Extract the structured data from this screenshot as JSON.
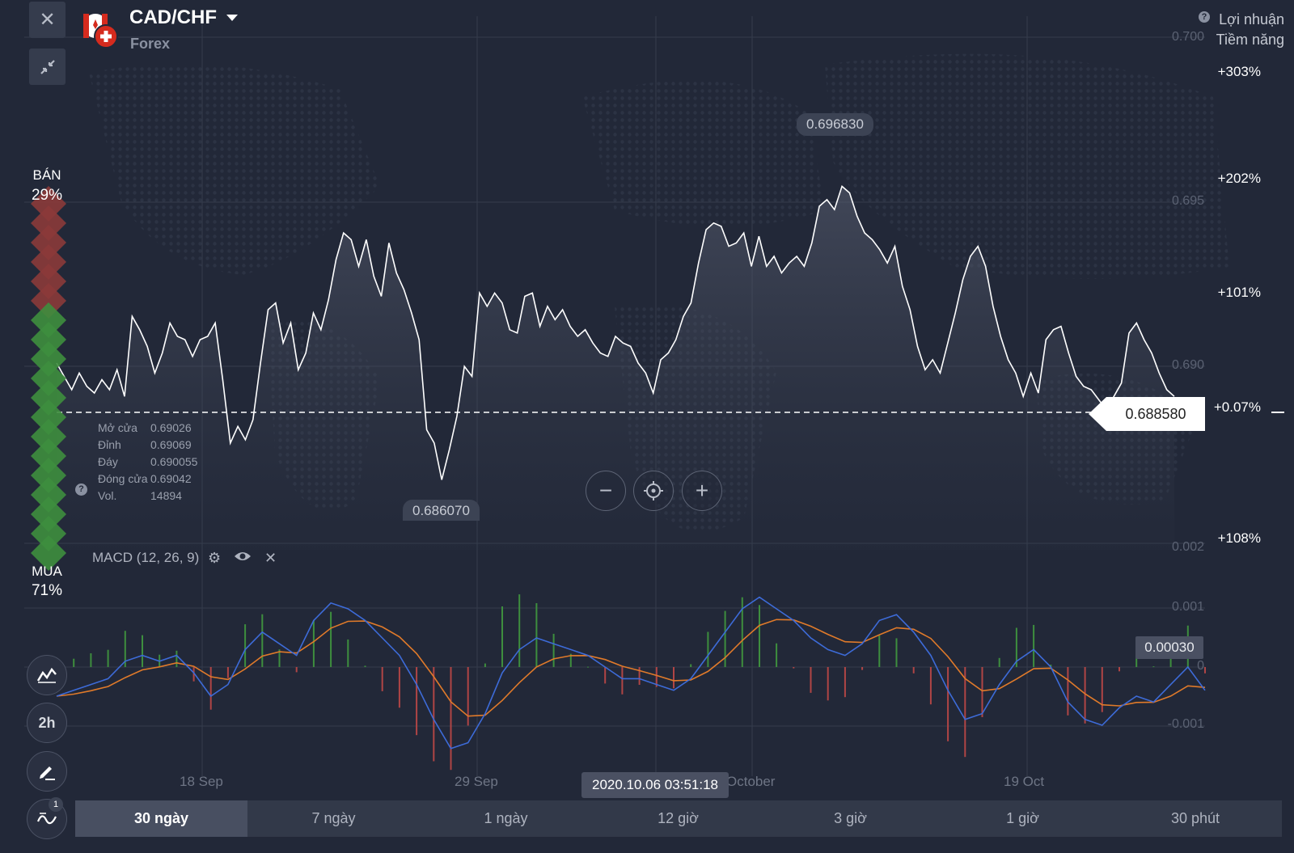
{
  "asset": {
    "name": "CAD/CHF",
    "type": "Forex"
  },
  "profit": {
    "title_line1": "Lợi nhuận",
    "title_line2": "Tiềm năng",
    "help": "?"
  },
  "profit_scale": [
    "+303%",
    "+202%",
    "+101%",
    "+0.07%",
    "+108%"
  ],
  "price_axis": [
    "0.700",
    "0.695",
    "0.690"
  ],
  "macd_axis": [
    "0.002",
    "0.001",
    "0",
    "-0.001"
  ],
  "sentiment": {
    "sell_label": "BÁN",
    "sell_pct": "29%",
    "buy_label": "MUA",
    "buy_pct": "71%",
    "sell_color": "#8b3a3a",
    "buy_color": "#3e8e3e"
  },
  "ohlc": {
    "open_label": "Mở cửa",
    "open": "0.69026",
    "high_label": "Đỉnh",
    "high": "0.69069",
    "low_label": "Đáy",
    "low": "0.690055",
    "close_label": "Đóng cửa",
    "close": "0.69042",
    "vol_label": "Vol.",
    "vol": "14894"
  },
  "markers": {
    "current_price": "0.688580",
    "high_bubble": "0.696830",
    "low_bubble": "0.686070"
  },
  "macd": {
    "label": "MACD (12, 26, 9)",
    "value": "0.00030",
    "line_color": "#3d6bd8",
    "signal_color": "#e07a2a"
  },
  "x_axis": [
    "18 Sep",
    "29 Sep",
    "October",
    "19 Oct"
  ],
  "time_tooltip": "2020.10.06 03:51:18",
  "tools": {
    "time_frame": "2h",
    "indicator_count": "1"
  },
  "timeframes": [
    "30 ngày",
    "7 ngày",
    "1 ngày",
    "12 giờ",
    "3 giờ",
    "1 giờ",
    "30 phút"
  ],
  "icons": {
    "close": "close-icon",
    "collapse": "collapse-icon",
    "zoom_out": "minus-icon",
    "center": "crosshair-icon",
    "zoom_in": "plus-icon"
  },
  "chart_data": {
    "type": "line",
    "ylim": [
      0.684,
      0.7
    ],
    "current": 0.68858,
    "x": [
      0,
      1,
      2,
      3,
      4,
      5,
      6,
      7,
      8,
      9,
      10,
      11,
      12,
      13,
      14,
      15,
      16,
      17,
      18,
      19,
      20,
      21,
      22,
      23,
      24,
      25,
      26,
      27,
      28,
      29,
      30,
      31,
      32,
      33,
      34,
      35,
      36,
      37,
      38,
      39,
      40,
      41,
      42,
      43,
      44,
      45,
      46,
      47,
      48,
      49,
      50,
      51,
      52,
      53,
      54,
      55,
      56,
      57,
      58,
      59,
      60,
      61,
      62,
      63,
      64,
      65,
      66,
      67,
      68,
      69,
      70,
      71,
      72,
      73,
      74,
      75,
      76,
      77,
      78,
      79,
      80,
      81,
      82,
      83,
      84,
      85,
      86,
      87,
      88,
      89,
      90,
      91,
      92,
      93,
      94,
      95,
      96,
      97,
      98,
      99,
      100,
      101,
      102,
      103,
      104,
      105,
      106,
      107,
      108,
      109,
      110,
      111,
      112,
      113,
      114,
      115,
      116,
      117,
      118,
      119,
      120,
      121,
      122,
      123,
      124,
      125,
      126,
      127,
      128,
      129,
      130,
      131,
      132,
      133,
      134,
      135,
      136,
      137,
      138,
      139,
      140,
      141,
      142,
      143,
      144,
      145,
      146,
      147,
      148,
      149,
      150,
      151,
      152,
      153,
      154,
      155,
      156,
      157,
      158,
      159,
      160,
      161,
      162,
      163,
      164,
      165,
      166,
      167,
      168,
      169,
      170,
      171,
      172,
      173,
      174,
      175,
      176,
      177,
      178,
      179
    ],
    "price": [
      0.6896,
      0.6892,
      0.6888,
      0.6893,
      0.6889,
      0.6887,
      0.6891,
      0.6888,
      0.6894,
      0.6886,
      0.691,
      0.6906,
      0.6901,
      0.6893,
      0.6899,
      0.6908,
      0.6904,
      0.6903,
      0.6898,
      0.6903,
      0.6904,
      0.6908,
      0.6891,
      0.6872,
      0.6877,
      0.6873,
      0.6879,
      0.6896,
      0.6912,
      0.6914,
      0.6902,
      0.6908,
      0.6894,
      0.6899,
      0.6911,
      0.6906,
      0.6915,
      0.6927,
      0.6935,
      0.6933,
      0.6925,
      0.6933,
      0.6922,
      0.6916,
      0.6932,
      0.6923,
      0.6918,
      0.6911,
      0.6903,
      0.6876,
      0.6872,
      0.6861,
      0.687,
      0.688,
      0.6895,
      0.6892,
      0.6917,
      0.6913,
      0.6917,
      0.6914,
      0.6906,
      0.6905,
      0.6916,
      0.6917,
      0.6907,
      0.6913,
      0.6909,
      0.6912,
      0.6907,
      0.6904,
      0.6906,
      0.6902,
      0.6899,
      0.6898,
      0.6904,
      0.6902,
      0.6901,
      0.6896,
      0.6893,
      0.6887,
      0.6897,
      0.6899,
      0.6903,
      0.691,
      0.6914,
      0.6926,
      0.6936,
      0.6938,
      0.6937,
      0.6931,
      0.6932,
      0.6935,
      0.6925,
      0.6934,
      0.6925,
      0.6928,
      0.6923,
      0.6926,
      0.6928,
      0.6925,
      0.6932,
      0.6943,
      0.6945,
      0.6942,
      0.6949,
      0.6947,
      0.694,
      0.6935,
      0.6933,
      0.693,
      0.6926,
      0.6931,
      0.6919,
      0.6912,
      0.6901,
      0.6894,
      0.6897,
      0.6893,
      0.6902,
      0.6911,
      0.6921,
      0.6928,
      0.6931,
      0.6925,
      0.6913,
      0.6904,
      0.6897,
      0.6893,
      0.6886,
      0.6893,
      0.6887,
      0.6903,
      0.6906,
      0.6907,
      0.6899,
      0.6892,
      0.6889,
      0.6888,
      0.6885,
      0.6882,
      0.6886,
      0.689,
      0.6905,
      0.6908,
      0.6903,
      0.6899,
      0.6893,
      0.6888,
      0.6886
    ],
    "macd": [
      -0.0005,
      -0.0004,
      -0.0003,
      -0.0002,
      0.0001,
      0.0002,
      0.0001,
      0.0002,
      -0.0001,
      -0.0005,
      -0.0003,
      0.0003,
      0.0006,
      0.0004,
      0.0002,
      0.0008,
      0.0011,
      0.001,
      0.0008,
      0.0005,
      0.0002,
      -0.0003,
      -0.0009,
      -0.0014,
      -0.0013,
      -0.0008,
      -0.0001,
      0.0003,
      0.0005,
      0.0004,
      0.0003,
      0.0002,
      0.0,
      -0.0002,
      -0.0002,
      -0.0003,
      -0.0004,
      -0.0002,
      0.0002,
      0.0006,
      0.001,
      0.0012,
      0.001,
      0.0008,
      0.0005,
      0.0003,
      0.0002,
      0.0004,
      0.0008,
      0.0009,
      0.0006,
      0.0002,
      -0.0004,
      -0.0009,
      -0.0008,
      -0.0003,
      0.0001,
      0.0003,
      0.0,
      -0.0006,
      -0.0009,
      -0.001,
      -0.0007,
      -0.0005,
      -0.0006,
      -0.0003,
      0.0,
      -0.0004
    ]
  }
}
